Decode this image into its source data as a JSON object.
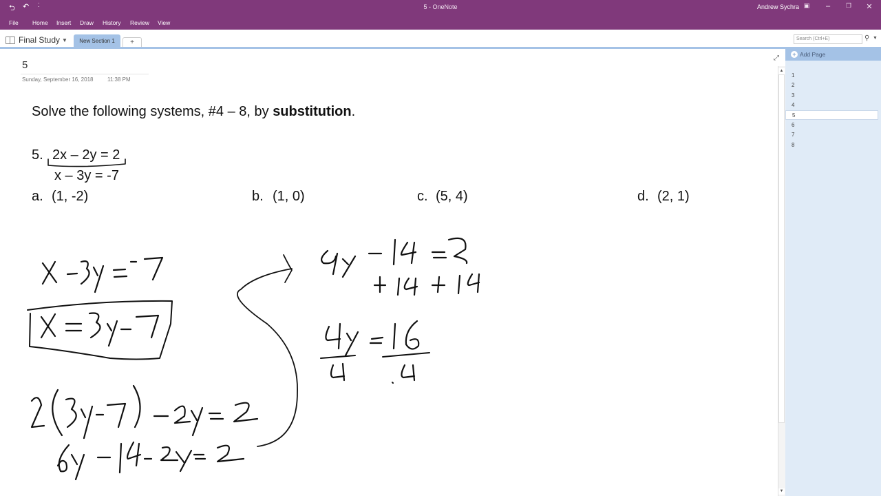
{
  "window": {
    "title": "5  -  OneNote",
    "user": "Andrew Sychra",
    "accent_color": "#80397b"
  },
  "quick_access": [
    "back-icon",
    "undo-icon",
    "customize-icon"
  ],
  "menu": [
    "File",
    "Home",
    "Insert",
    "Draw",
    "History",
    "Review",
    "View"
  ],
  "notebook": {
    "name": "Final Study",
    "section_tab": "New Section 1",
    "add_tab": "+"
  },
  "search": {
    "placeholder": "Search (Ctrl+E)"
  },
  "page": {
    "title": "5",
    "date": "Sunday, September 16, 2018",
    "time": "11:38 PM"
  },
  "content": {
    "instruction_prefix": "Solve the following systems, #4 – 8, by ",
    "instruction_bold": "substitution",
    "instruction_suffix": ".",
    "problem_number": "5.",
    "equation1": "2x – 2y = 2",
    "equation2": "x – 3y = -7",
    "choices": [
      {
        "label": "a.",
        "value": "(1, -2)"
      },
      {
        "label": "b.",
        "value": "(1, 0)"
      },
      {
        "label": "c.",
        "value": "(5, 4)"
      },
      {
        "label": "d.",
        "value": "(2, 1)"
      }
    ]
  },
  "handwriting": {
    "lines": [
      "x - 3y = -7",
      "x = 3y - 7",
      "2(3y - 7) - 2y = 2",
      "6y - 14 - 2y = 2",
      "4y - 14 = 2",
      "+14 +14",
      "4y = 16",
      "4   4"
    ]
  },
  "pages_panel": {
    "add_page_label": "Add Page",
    "pages": [
      "1",
      "2",
      "3",
      "4",
      "5",
      "6",
      "7",
      "8"
    ],
    "active_page": "5"
  }
}
